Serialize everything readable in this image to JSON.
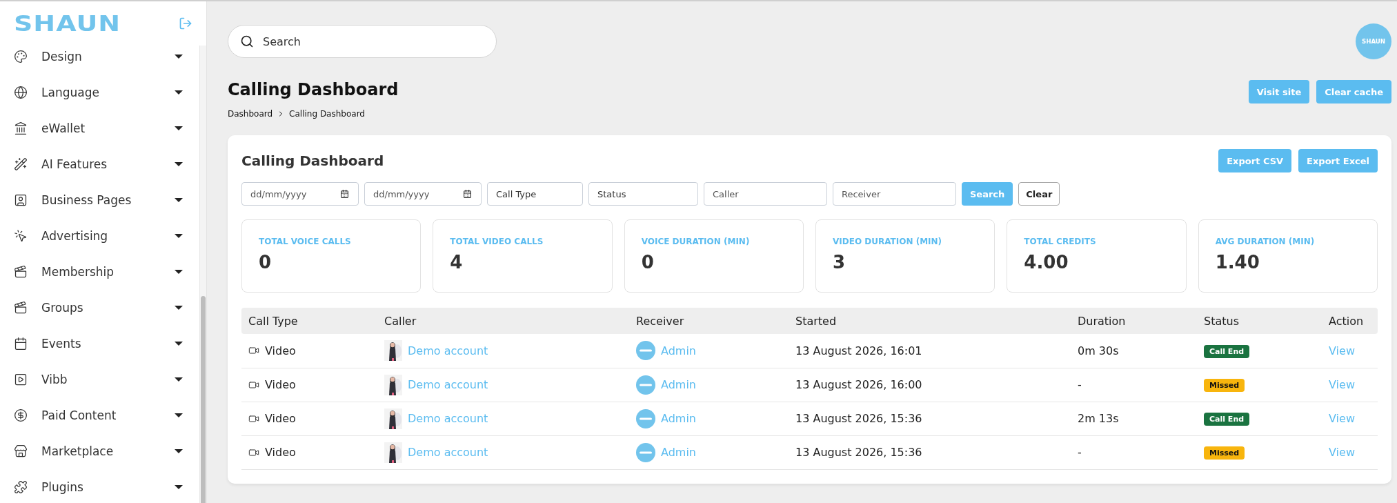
{
  "sidebar": {
    "logo": "SHAUN",
    "items": [
      {
        "label": "Design"
      },
      {
        "label": "Language"
      },
      {
        "label": "eWallet"
      },
      {
        "label": "AI Features"
      },
      {
        "label": "Business Pages"
      },
      {
        "label": "Advertising"
      },
      {
        "label": "Membership"
      },
      {
        "label": "Groups"
      },
      {
        "label": "Events"
      },
      {
        "label": "Vibb"
      },
      {
        "label": "Paid Content"
      },
      {
        "label": "Marketplace"
      },
      {
        "label": "Plugins"
      }
    ]
  },
  "topbar": {
    "search": {
      "placeholder": "Search"
    },
    "avatar": "SHAUN"
  },
  "page": {
    "title": "Calling Dashboard",
    "breadcrumb": [
      "Dashboard",
      "Calling Dashboard"
    ],
    "buttons": [
      "Visit site",
      "Clear cache"
    ]
  },
  "card": {
    "title": "Calling Dashboard",
    "export_buttons": [
      "Export CSV",
      "Export Excel"
    ],
    "filters": [
      {
        "kind": "date",
        "placeholder": "dd/mm/yyyy"
      },
      {
        "kind": "date",
        "placeholder": "dd/mm/yyyy"
      },
      {
        "kind": "select",
        "value": "Call Type"
      },
      {
        "kind": "select",
        "value": "Status"
      },
      {
        "kind": "text",
        "placeholder": "Caller"
      },
      {
        "kind": "text",
        "placeholder": "Receiver"
      }
    ],
    "search_button": "Search",
    "clear_button": "Clear",
    "stats": [
      {
        "label": "TOTAL VOICE CALLS",
        "value": "0"
      },
      {
        "label": "TOTAL VIDEO CALLS",
        "value": "4"
      },
      {
        "label": "VOICE DURATION (MIN)",
        "value": "0"
      },
      {
        "label": "VIDEO DURATION (MIN)",
        "value": "3"
      },
      {
        "label": "TOTAL CREDITS",
        "value": "4.00"
      },
      {
        "label": "AVG DURATION (MIN)",
        "value": "1.40"
      }
    ],
    "table": {
      "columns": [
        "Call Type",
        "Caller",
        "Receiver",
        "Started",
        "Duration",
        "Status",
        "Action"
      ],
      "rows": [
        {
          "call_type": "Video",
          "caller": "Demo account",
          "receiver": "Admin",
          "started": "13 August 2026, 16:01",
          "duration": "0m 30s",
          "status": {
            "kind": "call_end",
            "label": "Call End"
          },
          "action": "View"
        },
        {
          "call_type": "Video",
          "caller": "Demo account",
          "receiver": "Admin",
          "started": "13 August 2026, 16:00",
          "duration": "-",
          "status": {
            "kind": "missed",
            "label": "Missed"
          },
          "action": "View"
        },
        {
          "call_type": "Video",
          "caller": "Demo account",
          "receiver": "Admin",
          "started": "13 August 2026, 15:36",
          "duration": "2m 13s",
          "status": {
            "kind": "call_end",
            "label": "Call End"
          },
          "action": "View"
        },
        {
          "call_type": "Video",
          "caller": "Demo account",
          "receiver": "Admin",
          "started": "13 August 2026, 15:36",
          "duration": "-",
          "status": {
            "kind": "missed",
            "label": "Missed"
          },
          "action": "View"
        }
      ]
    }
  }
}
